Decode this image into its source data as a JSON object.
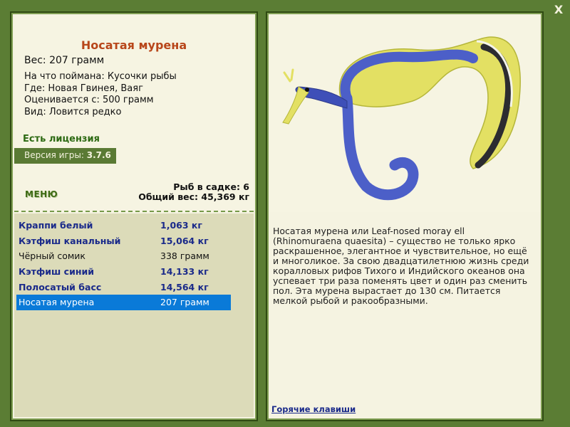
{
  "fish": {
    "name": "Носатая мурена",
    "weight_line": "Вес: 207 грамм",
    "details": [
      "На что поймана: Кусочки рыбы",
      "Где: Новая Гвинея, Ваяг",
      "Оценивается с: 500 грамм",
      "Вид: Ловится редко"
    ],
    "description": "Носатая мурена или Leaf-nosed moray ell (Rhinomuraena quaesita) – существо не только ярко раскрашенное, элегантное и чувствительное, но ещё и многоликое. За свою двадцатилетнюю жизнь среди коралловых рифов Тихого и Индийского океанов она успевает три раза поменять цвет и один раз сменить пол. Эта мурена вырастает до 130 см. Питается мелкой рыбой и ракообразными."
  },
  "license": "Есть лицензия",
  "version": {
    "label": "Версия игры:",
    "value": "3.7.6"
  },
  "menu_label": "МЕНЮ",
  "summary": {
    "fish_count": "Рыб в садке: 6",
    "total_weight": "Общий вес: 45,369 кг"
  },
  "catch_list": [
    {
      "name": "Краппи белый",
      "weight": "1,063 кг",
      "style": "record"
    },
    {
      "name": "Кэтфиш канальный",
      "weight": "15,064 кг",
      "style": "record"
    },
    {
      "name": "Чёрный сомик",
      "weight": "338 грамм",
      "style": "normal"
    },
    {
      "name": "Кэтфиш синий",
      "weight": "14,133 кг",
      "style": "record"
    },
    {
      "name": "Полосатый басс",
      "weight": "14,564 кг",
      "style": "record"
    },
    {
      "name": "Носатая мурена",
      "weight": "207 грамм",
      "style": "selected"
    }
  ],
  "hotkeys_label": "Горячие клавиши",
  "close_label": "X",
  "colors": {
    "background": "#5b7d34",
    "title": "#b8461a",
    "record": "#1a2a8a",
    "selected": "#0a7ad8",
    "eel_yellow": "#e3e063",
    "eel_blue": "#4c5fc8"
  }
}
